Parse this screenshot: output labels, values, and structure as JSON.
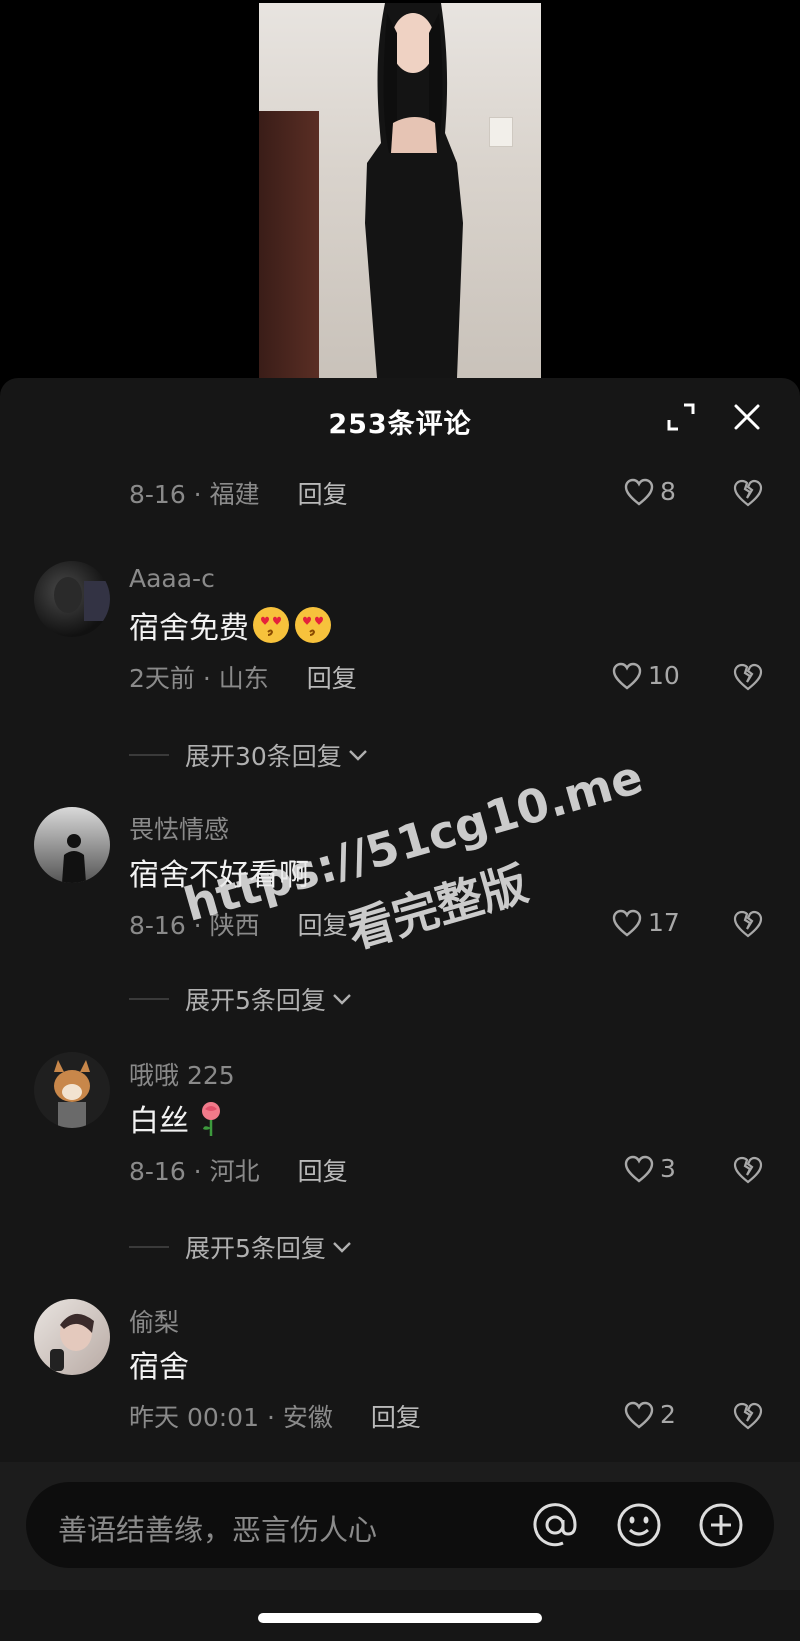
{
  "video": {},
  "header": {
    "title": "253条评论"
  },
  "comments": [
    {
      "meta_time_loc": "8-16 · 福建",
      "reply": "回复",
      "likes": "8"
    },
    {
      "user": "Aaaa-c",
      "text": "宿舍免费",
      "meta_time_loc": "2天前 · 山东",
      "reply": "回复",
      "likes": "10",
      "expand": "展开30条回复"
    },
    {
      "user": "畏怯情感",
      "text": "宿舍不好看啊",
      "meta_time_loc": "8-16 · 陕西",
      "reply": "回复",
      "likes": "17",
      "expand": "展开5条回复"
    },
    {
      "user": "哦哦 225",
      "text": "白丝",
      "meta_time_loc": "8-16 · 河北",
      "reply": "回复",
      "likes": "3",
      "expand": "展开5条回复"
    },
    {
      "user": "偷梨",
      "text": "宿舍",
      "meta_time_loc": "昨天 00:01 · 安徽",
      "reply": "回复",
      "likes": "2"
    }
  ],
  "watermark": {
    "line1": "https://51cg10.me",
    "line2": "看完整版"
  },
  "input": {
    "placeholder": "善语结善缘，恶言伤人心"
  },
  "icons": [
    "expand-icon",
    "close-icon",
    "heart-icon",
    "dislike-icon",
    "at-icon",
    "emoji-icon",
    "plus-icon"
  ],
  "colors": {
    "sheet_bg": "#161616",
    "muted": "#8a8a8a",
    "text": "#f2f2f2"
  }
}
